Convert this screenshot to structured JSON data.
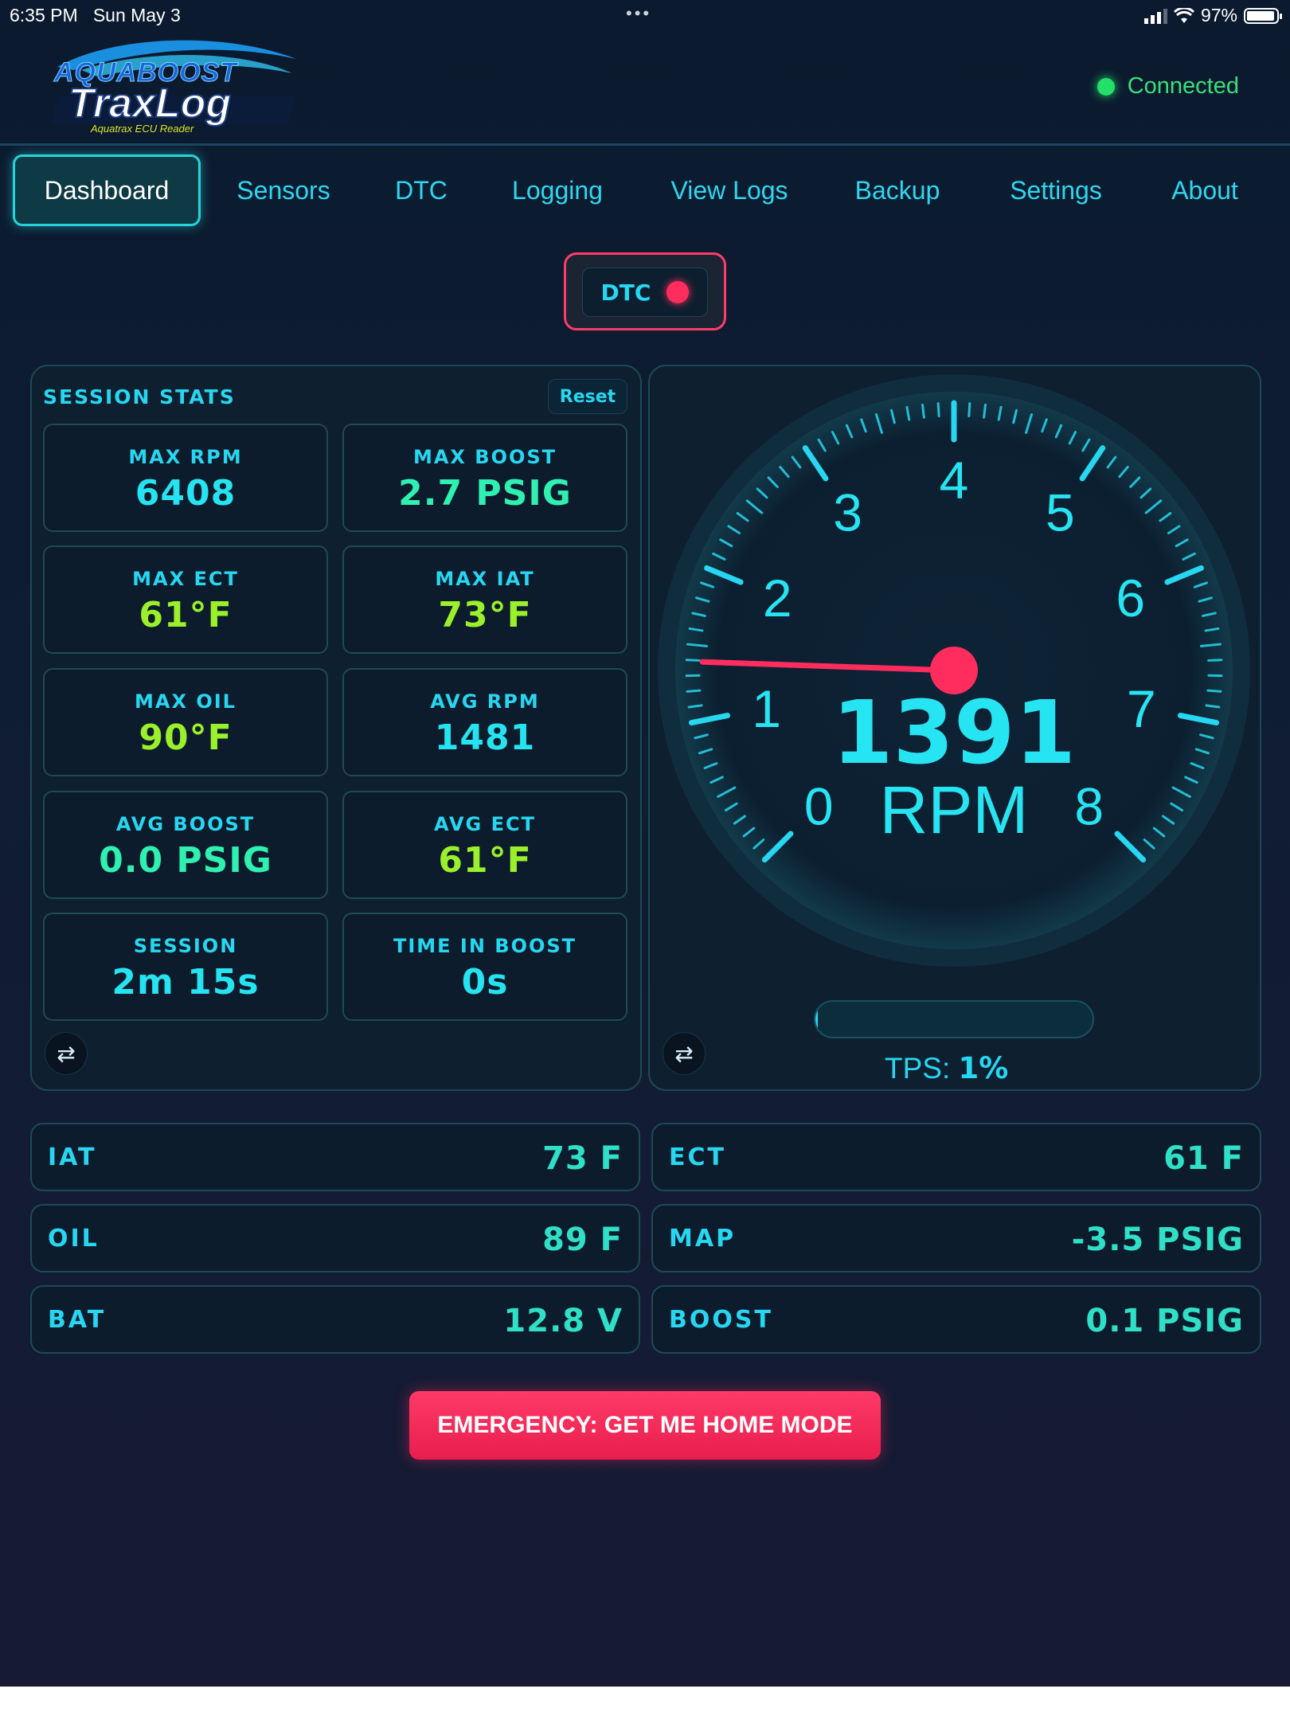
{
  "status_bar": {
    "time": "6:35 PM",
    "date": "Sun May 3",
    "battery": "97%"
  },
  "header": {
    "logo_top": "AQUABOOST",
    "logo_main": "TraxLog",
    "logo_sub": "Aquatrax ECU Reader",
    "connection": "Connected"
  },
  "nav": {
    "tabs": [
      {
        "label": "Dashboard",
        "active": true
      },
      {
        "label": "Sensors"
      },
      {
        "label": "DTC"
      },
      {
        "label": "Logging"
      },
      {
        "label": "View Logs"
      },
      {
        "label": "Backup"
      },
      {
        "label": "Settings"
      },
      {
        "label": "About"
      }
    ]
  },
  "dtc_button": {
    "label": "DTC"
  },
  "session_stats": {
    "title": "SESSION STATS",
    "reset_label": "Reset",
    "cards": [
      {
        "label": "MAX RPM",
        "value": "6408"
      },
      {
        "label": "MAX BOOST",
        "value": "2.7 PSIG"
      },
      {
        "label": "MAX ECT",
        "value": "61°F"
      },
      {
        "label": "MAX IAT",
        "value": "73°F"
      },
      {
        "label": "MAX OIL",
        "value": "90°F"
      },
      {
        "label": "AVG RPM",
        "value": "1481"
      },
      {
        "label": "AVG BOOST",
        "value": "0.0 PSIG"
      },
      {
        "label": "AVG ECT",
        "value": "61°F"
      },
      {
        "label": "SESSION",
        "value": "2m 15s"
      },
      {
        "label": "TIME IN BOOST",
        "value": "0s"
      }
    ]
  },
  "gauge": {
    "rpm": "1391",
    "rpm_value": 1391,
    "unit": "RPM",
    "max_thousands": 8,
    "scale_labels": [
      "0",
      "1",
      "2",
      "3",
      "4",
      "5",
      "6",
      "7",
      "8"
    ],
    "tps_label": "TPS:",
    "tps_value": "1%",
    "tps_fraction": 0.01
  },
  "sensors": [
    {
      "key": "IAT",
      "value": "73 F"
    },
    {
      "key": "ECT",
      "value": "61 F"
    },
    {
      "key": "OIL",
      "value": "89 F"
    },
    {
      "key": "MAP",
      "value": "-3.5 PSIG"
    },
    {
      "key": "BAT",
      "value": "12.8 V"
    },
    {
      "key": "BOOST",
      "value": "0.1 PSIG"
    }
  ],
  "emergency_button": "EMERGENCY: GET ME HOME MODE",
  "colors": {
    "accent": "#27d6f0",
    "alert": "#ff2c5e",
    "connected": "#22e06a"
  }
}
